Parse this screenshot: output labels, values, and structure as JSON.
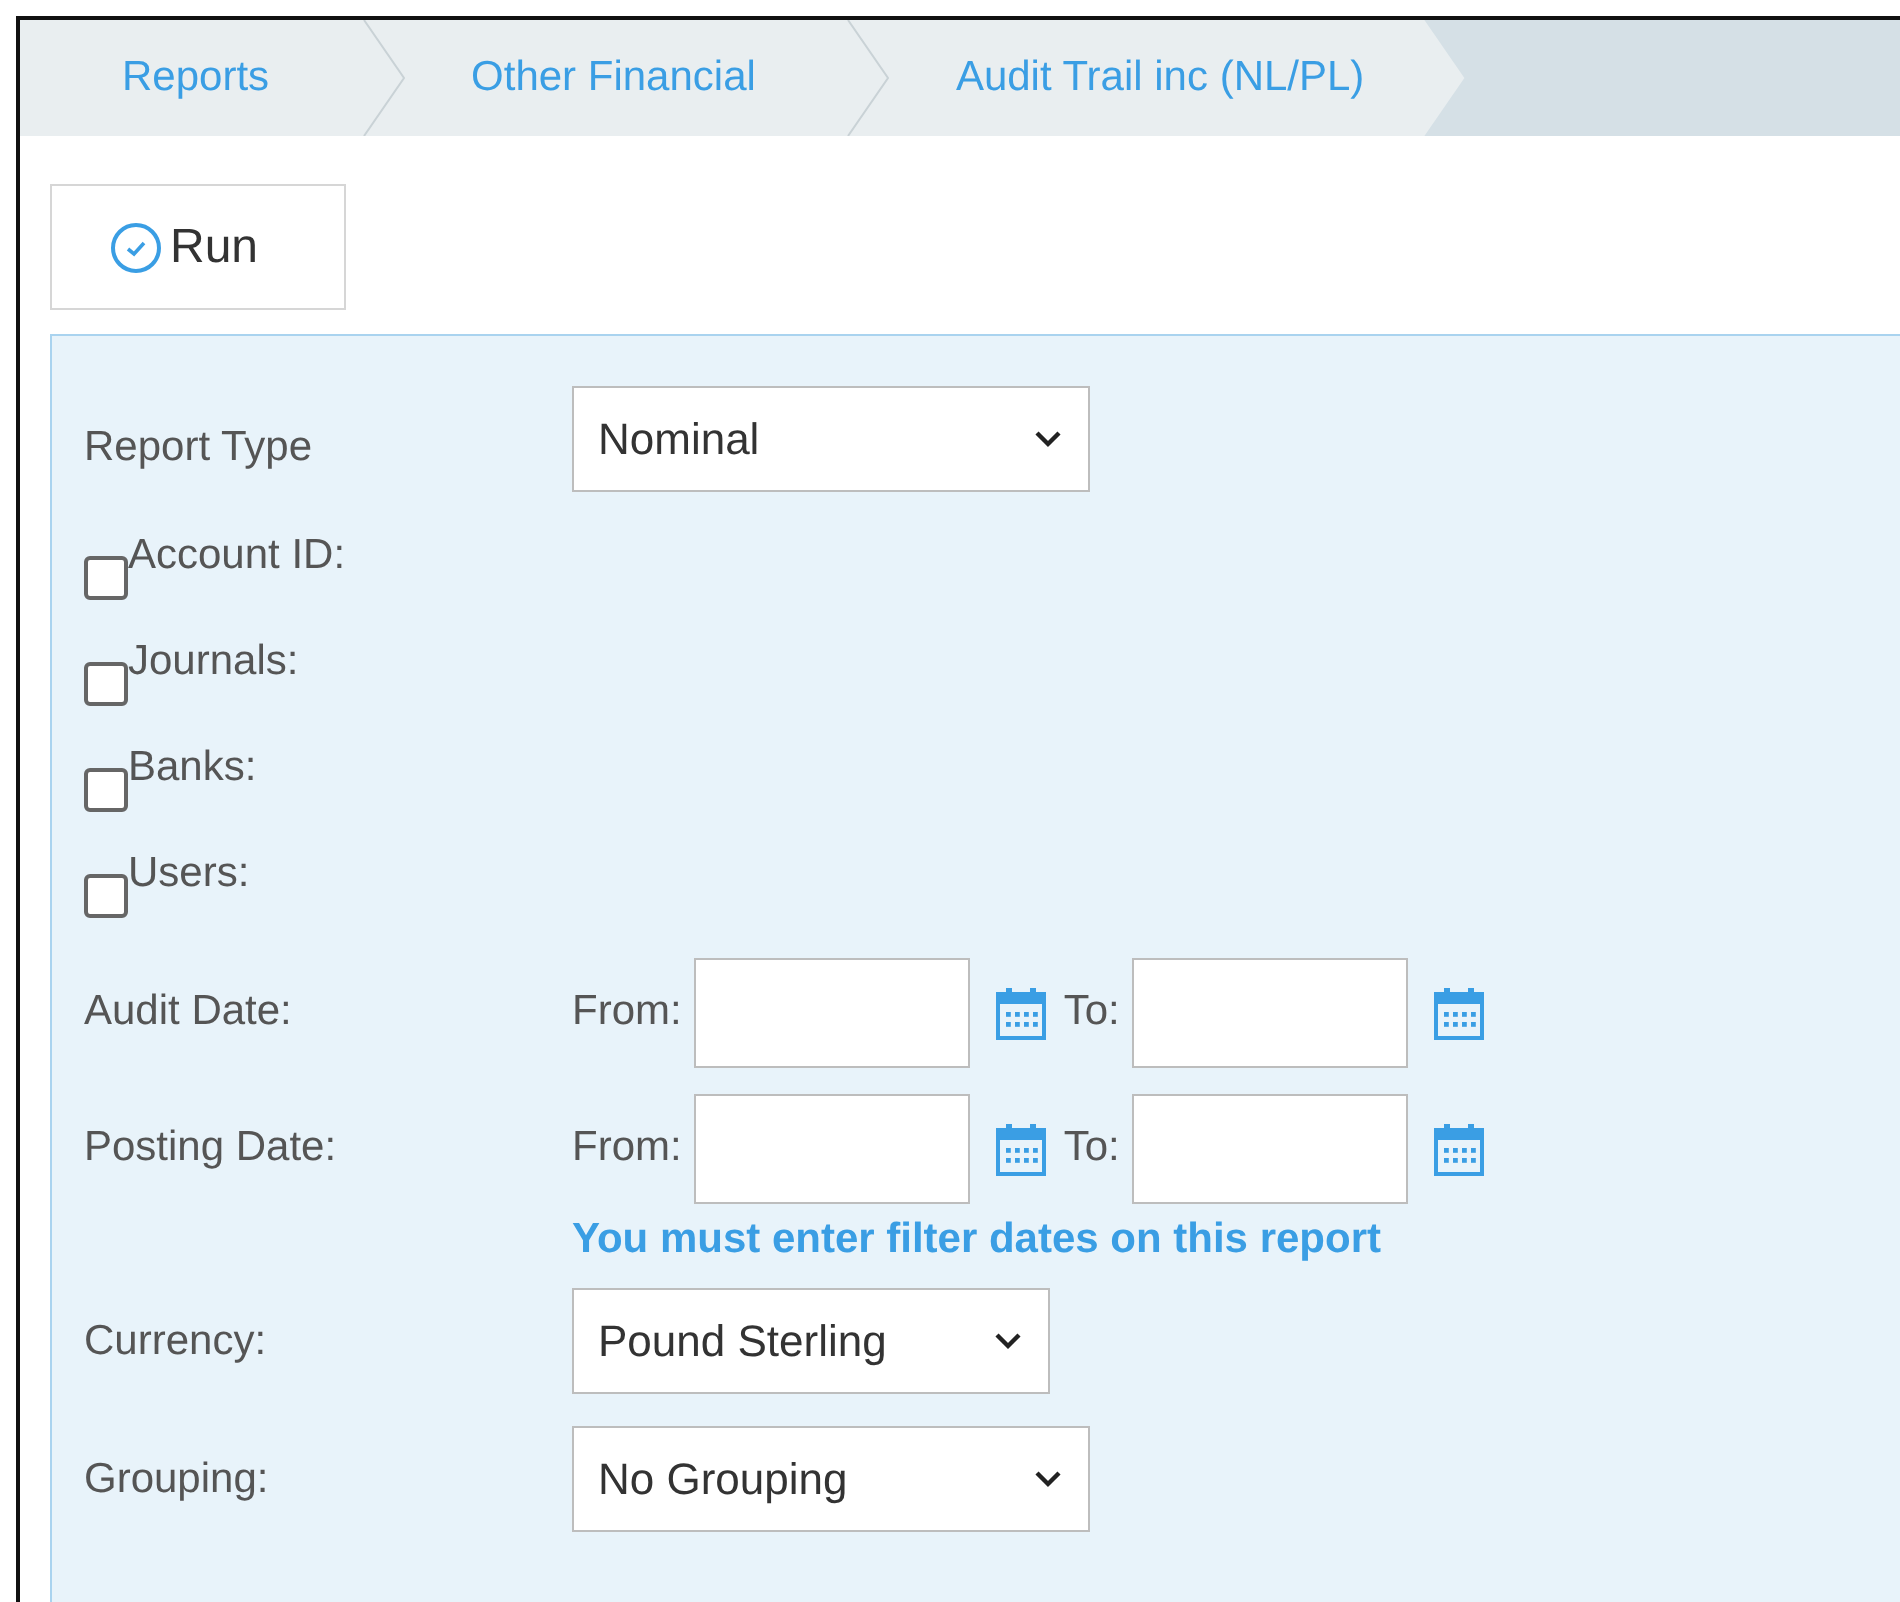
{
  "breadcrumbs": [
    {
      "label": "Reports"
    },
    {
      "label": "Other Financial"
    },
    {
      "label": "Audit Trail inc (NL/PL)"
    }
  ],
  "run_button": {
    "label": "Run"
  },
  "report_type": {
    "label": "Report Type",
    "value": "Nominal"
  },
  "filters": [
    {
      "label": "Account ID:",
      "checked": false
    },
    {
      "label": "Journals:",
      "checked": false
    },
    {
      "label": "Banks:",
      "checked": false
    },
    {
      "label": "Users:",
      "checked": false
    }
  ],
  "date_ranges": [
    {
      "label": "Audit Date:",
      "from_label": "From:",
      "to_label": "To:"
    },
    {
      "label": "Posting Date:",
      "from_label": "From:",
      "to_label": "To:"
    }
  ],
  "warning": "You must enter filter dates on this report",
  "selects": [
    {
      "label": "Currency:",
      "value": "Pound Sterling",
      "kind": "short"
    },
    {
      "label": "Grouping:",
      "value": "No Grouping",
      "kind": "wide"
    }
  ]
}
